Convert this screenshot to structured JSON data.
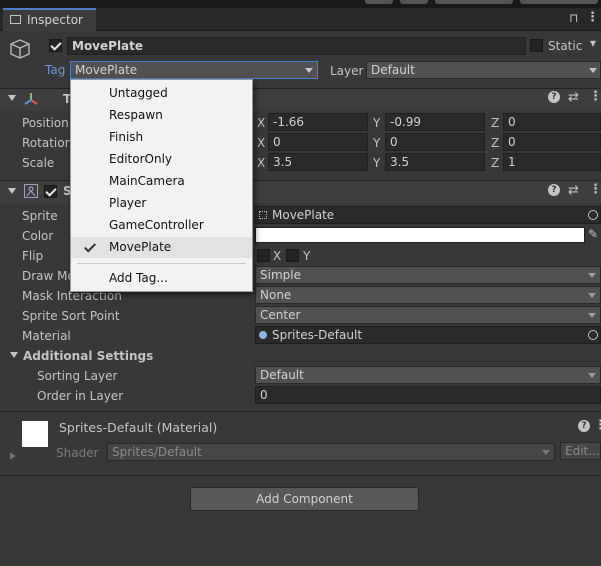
{
  "window": {
    "tab_title": "Inspector"
  },
  "object": {
    "name": "MovePlate",
    "static_label": "Static",
    "tag_label": "Tag",
    "tag_value": "MovePlate",
    "layer_label": "Layer",
    "layer_value": "Default"
  },
  "transform": {
    "header_letter": "T",
    "rows": [
      {
        "label": "Position",
        "x": "-1.66",
        "y": "-0.99",
        "z": "0"
      },
      {
        "label": "Rotation",
        "x": "0",
        "y": "0",
        "z": "0"
      },
      {
        "label": "Scale",
        "x": "3.5",
        "y": "3.5",
        "z": "1"
      }
    ],
    "axis_x": "X",
    "axis_y": "Y",
    "axis_z": "Z"
  },
  "sprite_renderer": {
    "header_letter": "S",
    "sprite_label": "Sprite",
    "sprite_value": "MovePlate",
    "color_label": "Color",
    "color_value": "#ffffff",
    "flip_label": "Flip",
    "flip_x": "X",
    "flip_y": "Y",
    "draw_mode_label": "Draw Mo",
    "draw_mode_value": "Simple",
    "mask_label": "Mask Interaction",
    "mask_value": "None",
    "sort_point_label": "Sprite Sort Point",
    "sort_point_value": "Center",
    "material_label": "Material",
    "material_value": "Sprites-Default",
    "additional_label": "Additional Settings",
    "sorting_layer_label": "Sorting Layer",
    "sorting_layer_value": "Default",
    "order_label": "Order in Layer",
    "order_value": "0"
  },
  "material": {
    "title": "Sprites-Default (Material)",
    "shader_label": "Shader",
    "shader_value": "Sprites/Default",
    "edit_label": "Edit..."
  },
  "add_component_label": "Add Component",
  "tag_menu": {
    "items": [
      "Untagged",
      "Respawn",
      "Finish",
      "EditorOnly",
      "MainCamera",
      "Player",
      "GameController",
      "MovePlate"
    ],
    "selected": "MovePlate",
    "add_tag": "Add Tag..."
  },
  "colors": {
    "accent": "#4a7fd0",
    "background": "#383838",
    "menu_bg": "#f2f2f2"
  }
}
